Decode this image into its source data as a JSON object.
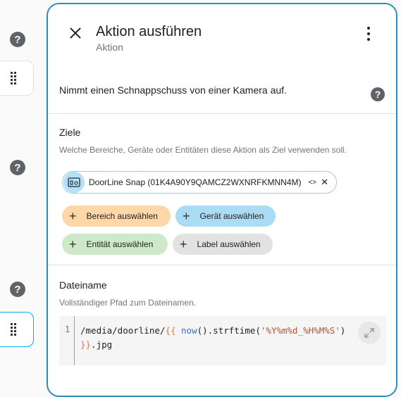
{
  "background": {
    "help_icon_1": "?",
    "help_icon_2": "?",
    "help_icon_3": "?"
  },
  "dialog": {
    "title": "Aktion ausführen",
    "subtitle": "Aktion",
    "description": "Nimmt einen Schnappschuss von einer Kamera auf.",
    "help_glyph": "?"
  },
  "targets": {
    "title": "Ziele",
    "subtitle": "Welche Bereiche, Geräte oder Entitäten diese Aktion als Ziel verwenden soll.",
    "selected_chip": {
      "label": "DoorLine Snap (01K4A90Y9QAMCZ2WXNRFKMNN4M)",
      "code_icon": "<>",
      "remove_icon": "✕"
    },
    "buttons": [
      {
        "label": "Bereich auswählen",
        "color": "#fdd7a8"
      },
      {
        "label": "Gerät auswählen",
        "color": "#aadcf4"
      },
      {
        "label": "Entität auswählen",
        "color": "#cde9c8"
      },
      {
        "label": "Label auswählen",
        "color": "#e2e2e2"
      }
    ],
    "plus_glyph": "+"
  },
  "filename": {
    "title": "Dateiname",
    "subtitle": "Vollständiger Pfad zum Dateinamen.",
    "line_number": "1",
    "code": {
      "prefix": "/media/doorline/",
      "open_brace": "{{",
      "fn": "now",
      "mid": "().strftime(",
      "str": "'%Y%m%d_%H%M%S'",
      "close": ")",
      "close_brace": "}}",
      "suffix": ".jpg"
    }
  },
  "colors": {
    "accent": "#2a8fbd"
  }
}
